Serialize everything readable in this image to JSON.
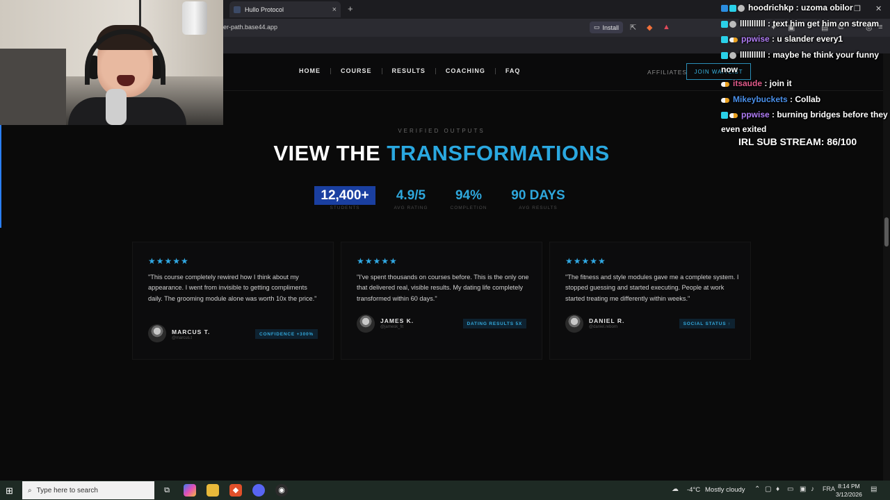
{
  "browser": {
    "tab_title": "Hullo Protocol",
    "tab_close": "×",
    "new_tab": "+",
    "url": "dier-path.base44.app",
    "install_label": "Install"
  },
  "site": {
    "nav": [
      {
        "label": "HOME"
      },
      {
        "label": "COURSE"
      },
      {
        "label": "RESULTS"
      },
      {
        "label": "COACHING"
      },
      {
        "label": "FAQ"
      }
    ],
    "affiliates": "AFFILIATES",
    "cta": "JOIN WAITLIST",
    "eyebrow": "VERIFIED OUTPUTS",
    "headline_plain": "VIEW THE",
    "headline_accent": "TRANSFORMATIONS",
    "stats": [
      {
        "value": "12,400+",
        "label": "STUDENTS",
        "selected": true
      },
      {
        "value": "4.9/5",
        "label": "AVG RATING"
      },
      {
        "value": "94%",
        "label": "COMPLETION"
      },
      {
        "value": "90 DAYS",
        "label": "AVG RESULTS"
      }
    ],
    "testimonials": [
      {
        "stars": "★★★★★",
        "quote": "\"This course completely rewired how I think about my appearance. I went from invisible to getting compliments daily. The grooming module alone was worth 10x the price.\"",
        "name": "MARCUS T.",
        "handle": "@marcus.t",
        "badge": "CONFIDENCE +300%"
      },
      {
        "stars": "★★★★★",
        "quote": "\"I've spent thousands on courses before. This is the only one that delivered real, visible results. My dating life completely transformed within 60 days.\"",
        "name": "JAMES K.",
        "handle": "@jamesk_fit",
        "badge": "DATING RESULTS 5X"
      },
      {
        "stars": "★★★★★",
        "quote": "\"The fitness and style modules gave me a complete system. I stopped guessing and started executing. People at work started treating me differently within weeks.\"",
        "name": "DANIEL R.",
        "handle": "@daniel.reborn",
        "badge": "SOCIAL STATUS ↑"
      }
    ]
  },
  "chat": {
    "messages": [
      {
        "user": "hoodrichkp",
        "text": " : uzoma obilor",
        "color": "#ffffff"
      },
      {
        "user": "lllllllllll",
        "text": " : text him get him on stream",
        "color": "#ffffff"
      },
      {
        "user": "ppwise",
        "text": " : u slander every1",
        "color": "#b07cf5"
      },
      {
        "user": "lllllllllll",
        "text": " : maybe he think your funny now",
        "color": "#ffffff"
      },
      {
        "user": "itsaude",
        "text": " : join it",
        "color": "#e05a8a"
      },
      {
        "user": "Mikeybuckets",
        "text": " : Collab",
        "color": "#4a8fe8"
      },
      {
        "user": "ppwise",
        "text": " : burning bridges before they even exited",
        "color": "#b07cf5"
      }
    ],
    "sub_goal": "IRL SUB STREAM: 86/100"
  },
  "taskbar": {
    "search_placeholder": "Type here to search",
    "weather_temp": "-4°C",
    "weather_text": "Mostly cloudy",
    "lang": "FRA",
    "time": "8:14 PM",
    "date": "3/12/2026"
  }
}
